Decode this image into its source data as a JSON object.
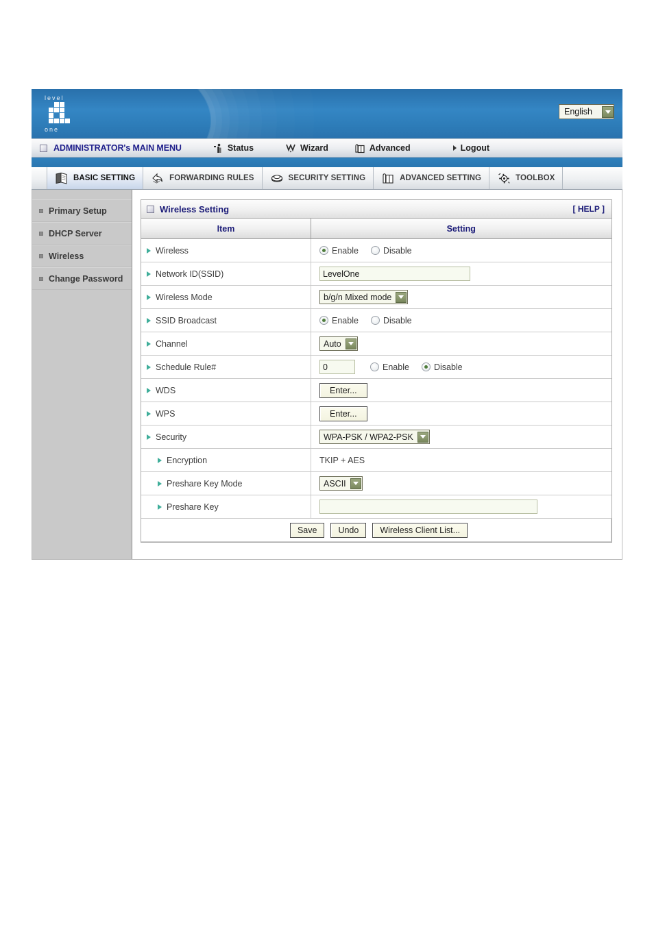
{
  "brand": {
    "logo_top": "level",
    "logo_bottom": "one"
  },
  "header": {
    "language_label": "English",
    "language_icon": "chevron-down-icon"
  },
  "main_menu": {
    "admin_label": "ADMINISTRATOR's MAIN MENU",
    "items": [
      {
        "label": "Status",
        "icon": "status-icon"
      },
      {
        "label": "Wizard",
        "icon": "wizard-icon"
      },
      {
        "label": "Advanced",
        "icon": "advanced-icon"
      },
      {
        "label": "Logout",
        "icon": "arrow-right-icon"
      }
    ]
  },
  "tabs": [
    {
      "label": "BASIC SETTING",
      "icon": "book-icon",
      "active": true
    },
    {
      "label": "FORWARDING RULES",
      "icon": "forward-icon",
      "active": false
    },
    {
      "label": "SECURITY SETTING",
      "icon": "shield-icon",
      "active": false
    },
    {
      "label": "ADVANCED SETTING",
      "icon": "advanced-icon",
      "active": false
    },
    {
      "label": "TOOLBOX",
      "icon": "toolbox-icon",
      "active": false
    }
  ],
  "sidebar": {
    "items": [
      {
        "label": "Primary Setup"
      },
      {
        "label": "DHCP Server"
      },
      {
        "label": "Wireless"
      },
      {
        "label": "Change Password"
      }
    ]
  },
  "panel": {
    "title": "Wireless Setting",
    "help_label": "[ HELP ]",
    "columns": {
      "item": "Item",
      "setting": "Setting"
    }
  },
  "rows": {
    "wireless": {
      "label": "Wireless",
      "enable_label": "Enable",
      "disable_label": "Disable",
      "selected": "Enable"
    },
    "ssid": {
      "label": "Network ID(SSID)",
      "value": "LevelOne",
      "placeholder": ""
    },
    "wireless_mode": {
      "label": "Wireless Mode",
      "value": "b/g/n Mixed mode"
    },
    "ssid_broadcast": {
      "label": "SSID Broadcast",
      "enable_label": "Enable",
      "disable_label": "Disable",
      "selected": "Enable"
    },
    "channel": {
      "label": "Channel",
      "value": "Auto"
    },
    "schedule_rule": {
      "label": "Schedule Rule#",
      "value": "0",
      "enable_label": "Enable",
      "disable_label": "Disable",
      "selected": "Disable"
    },
    "wds": {
      "label": "WDS",
      "button_label": "Enter..."
    },
    "wps": {
      "label": "WPS",
      "button_label": "Enter..."
    },
    "security": {
      "label": "Security",
      "value": "WPA-PSK / WPA2-PSK"
    },
    "encryption": {
      "label": "Encryption",
      "value": "TKIP + AES"
    },
    "preshare_key_mode": {
      "label": "Preshare Key Mode",
      "value": "ASCII"
    },
    "preshare_key": {
      "label": "Preshare Key",
      "value": "",
      "placeholder": ""
    }
  },
  "footer": {
    "save_label": "Save",
    "undo_label": "Undo",
    "client_list_label": "Wireless Client List..."
  },
  "colors": {
    "banner_blue": "#2e7ebb",
    "heading_navy": "#1c1c78",
    "arrow_teal": "#3fae9a",
    "radio_dot": "#4f7d3c",
    "sidebar_gray": "#c9c9c9",
    "field_bg": "#f7faf0",
    "button_bg": "#f3f3e0"
  }
}
